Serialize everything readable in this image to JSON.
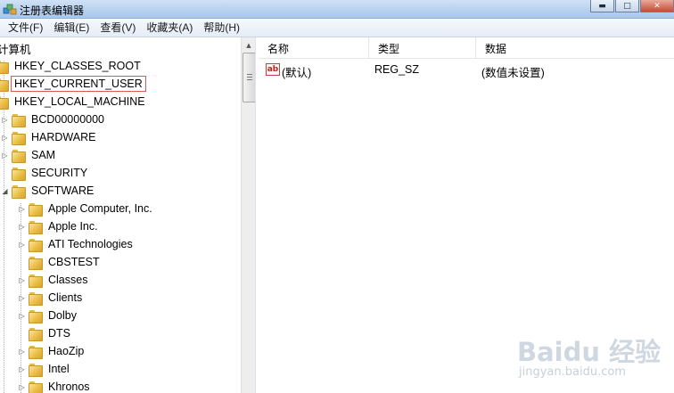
{
  "window": {
    "title": "注册表编辑器",
    "min_glyph": "▬",
    "max_glyph": "□",
    "close_glyph": "✕"
  },
  "menu": [
    "文件(F)",
    "编辑(E)",
    "查看(V)",
    "收藏夹(A)",
    "帮助(H)"
  ],
  "tree": {
    "root": "计算机",
    "items": [
      {
        "label": "HKEY_CLASSES_ROOT",
        "expander": ""
      },
      {
        "label": "HKEY_CURRENT_USER",
        "expander": ""
      },
      {
        "label": "HKEY_LOCAL_MACHINE",
        "expander": ""
      },
      {
        "label": "BCD00000000",
        "expander": "▷"
      },
      {
        "label": "HARDWARE",
        "expander": "▷"
      },
      {
        "label": "SAM",
        "expander": "▷"
      },
      {
        "label": "SECURITY",
        "expander": ""
      },
      {
        "label": "SOFTWARE",
        "expander": "◢"
      },
      {
        "label": "Apple Computer, Inc.",
        "expander": "▷"
      },
      {
        "label": "Apple Inc.",
        "expander": "▷"
      },
      {
        "label": "ATI Technologies",
        "expander": "▷"
      },
      {
        "label": "CBSTEST",
        "expander": ""
      },
      {
        "label": "Classes",
        "expander": "▷"
      },
      {
        "label": "Clients",
        "expander": "▷"
      },
      {
        "label": "Dolby",
        "expander": "▷"
      },
      {
        "label": "DTS",
        "expander": ""
      },
      {
        "label": "HaoZip",
        "expander": "▷"
      },
      {
        "label": "Intel",
        "expander": "▷"
      },
      {
        "label": "Khronos",
        "expander": "▷"
      }
    ],
    "highlighted": "HKEY_CURRENT_USER"
  },
  "values": {
    "columns": {
      "name": "名称",
      "type": "类型",
      "data": "数据"
    },
    "rows": [
      {
        "icon": "ab",
        "name": "(默认)",
        "type": "REG_SZ",
        "data": "(数值未设置)"
      }
    ]
  },
  "watermark": {
    "brand": "Baidu 经验",
    "sub": "jingyan.baidu.com"
  }
}
